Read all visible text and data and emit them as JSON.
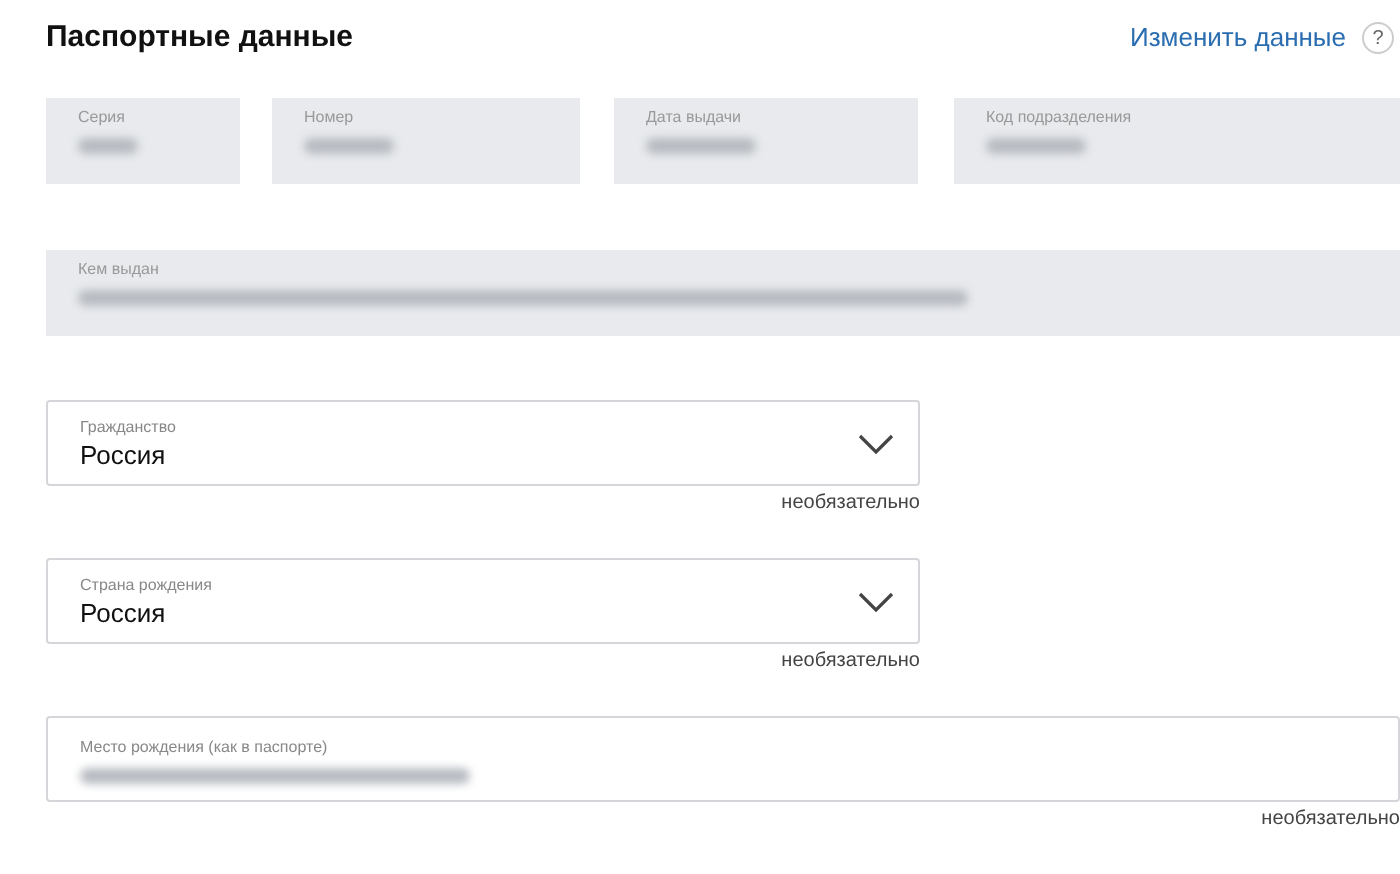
{
  "header": {
    "title": "Паспортные данные",
    "edit_link": "Изменить данные",
    "help": "?"
  },
  "readonly_row": [
    {
      "label": "Серия"
    },
    {
      "label": "Номер"
    },
    {
      "label": "Дата выдачи"
    },
    {
      "label": "Код подразделения"
    }
  ],
  "issued_by": {
    "label": "Кем выдан"
  },
  "fields": [
    {
      "kind": "select",
      "label": "Гражданство",
      "value": "Россия",
      "hint": "необязательно"
    },
    {
      "kind": "select",
      "label": "Страна рождения",
      "value": "Россия",
      "hint": "необязательно"
    },
    {
      "kind": "text",
      "label": "Место рождения (как в паспорте)",
      "hint": "необязательно"
    }
  ]
}
